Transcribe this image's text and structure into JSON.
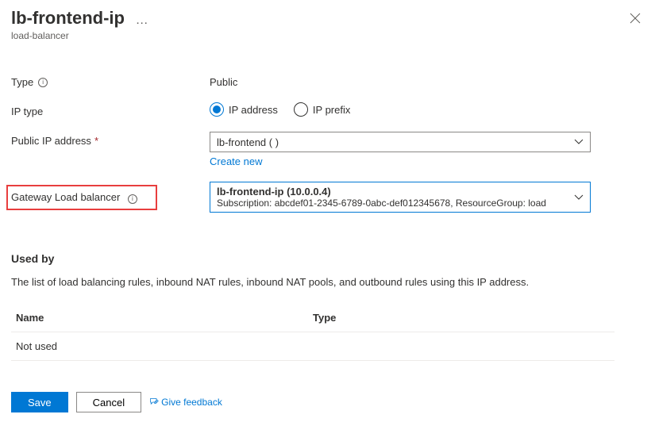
{
  "header": {
    "title": "lb-frontend-ip",
    "subtitle": "load-balancer"
  },
  "form": {
    "type": {
      "label": "Type",
      "value": "Public"
    },
    "ipType": {
      "label": "IP type",
      "options": {
        "address": "IP address",
        "prefix": "IP prefix"
      }
    },
    "publicIp": {
      "label": "Public IP address",
      "selected": "lb-frontend (                            )",
      "createNew": "Create new"
    },
    "gateway": {
      "label": "Gateway Load balancer",
      "selectedMain": "lb-frontend-ip (10.0.0.4)",
      "selectedSub": "Subscription: abcdef01-2345-6789-0abc-def012345678, ResourceGroup: load"
    }
  },
  "usedBy": {
    "title": "Used by",
    "desc": "The list of load balancing rules, inbound NAT rules, inbound NAT pools, and outbound rules using this IP address.",
    "cols": {
      "name": "Name",
      "type": "Type"
    },
    "empty": "Not used"
  },
  "footer": {
    "save": "Save",
    "cancel": "Cancel",
    "feedback": "Give feedback"
  }
}
